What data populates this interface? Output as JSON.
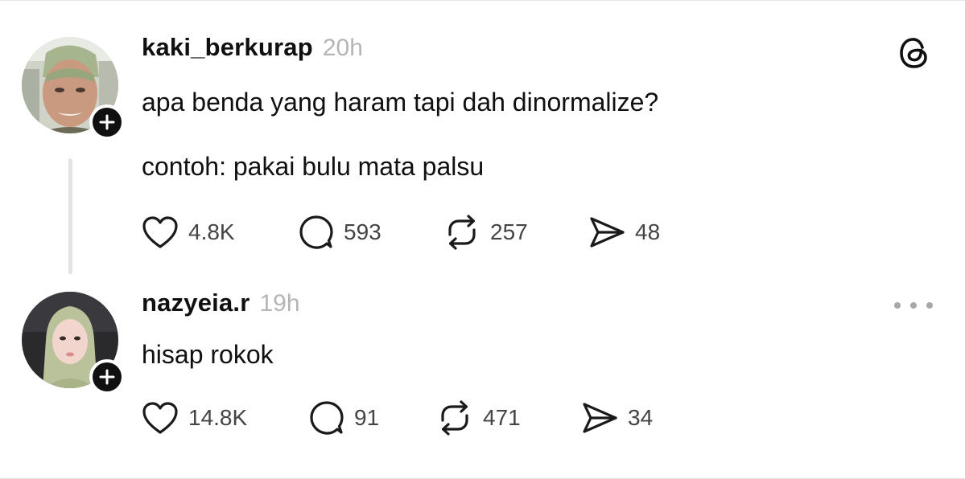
{
  "app": {
    "name": "Threads"
  },
  "posts": [
    {
      "username": "kaki_berkurap",
      "time": "20h",
      "text_lines": [
        "apa benda yang haram tapi dah dinormalize?",
        "contoh: pakai bulu mata palsu"
      ],
      "likes": "4.8K",
      "replies": "593",
      "reposts": "257",
      "shares": "48"
    },
    {
      "username": "nazyeia.r",
      "time": "19h",
      "text_lines": [
        "hisap rokok"
      ],
      "likes": "14.8K",
      "replies": "91",
      "reposts": "471",
      "shares": "34"
    }
  ],
  "icons": {
    "logo": "threads-logo-icon",
    "follow": "plus-icon",
    "like": "heart-icon",
    "reply": "speech-bubble-icon",
    "repost": "repost-arrows-icon",
    "share": "paper-plane-icon",
    "more": "more-dots-icon"
  },
  "colors": {
    "text": "#101010",
    "muted": "#b5b5b5",
    "count": "#444444",
    "thread_line": "#e3e3e3"
  }
}
